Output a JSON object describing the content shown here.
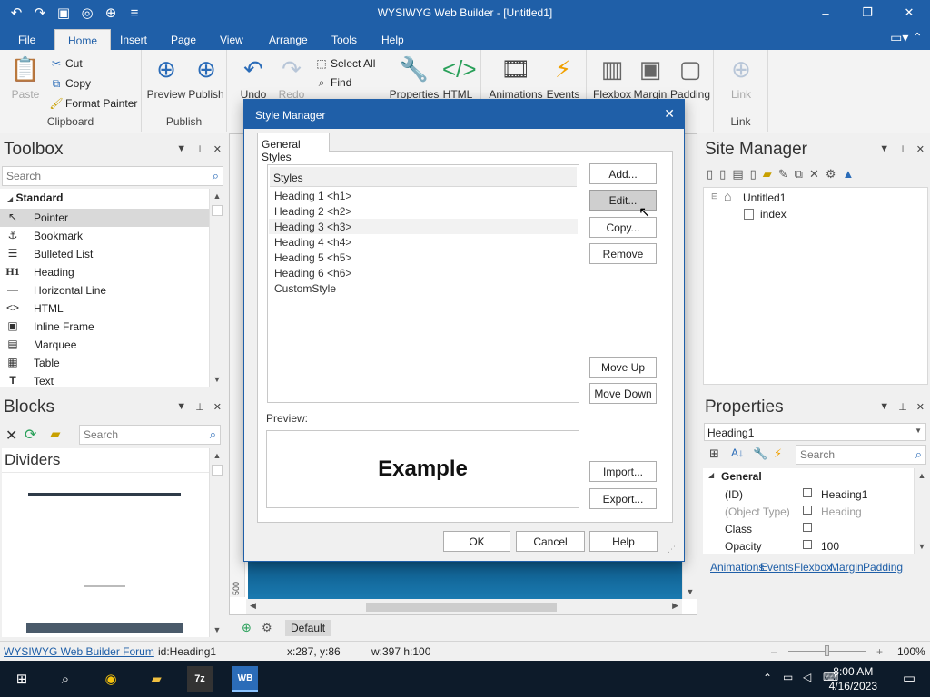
{
  "window": {
    "title": "WYSIWYG Web Builder - [Untitled1]",
    "minimize": "–",
    "restore": "❐",
    "close": "✕"
  },
  "ribbon_tabs": [
    {
      "label": "File",
      "active": false
    },
    {
      "label": "Home",
      "active": true
    },
    {
      "label": "Insert",
      "active": false
    },
    {
      "label": "Page",
      "active": false
    },
    {
      "label": "View",
      "active": false
    },
    {
      "label": "Arrange",
      "active": false
    },
    {
      "label": "Tools",
      "active": false
    },
    {
      "label": "Help",
      "active": false
    }
  ],
  "ribbon": {
    "clipboard": {
      "title": "Clipboard",
      "paste": "Paste",
      "cut": "Cut",
      "copy": "Copy",
      "format_painter": "Format Painter"
    },
    "publish": {
      "title": "Publish",
      "preview": "Preview",
      "publish": "Publish"
    },
    "edit": {
      "undo": "Undo",
      "redo": "Redo",
      "select_all": "Select All",
      "find": "Find"
    },
    "properties": {
      "properties": "Properties",
      "html": "HTML"
    },
    "animations": {
      "animations": "Animations",
      "events": "Events"
    },
    "layout": {
      "flexbox": "Flexbox",
      "margin": "Margin",
      "padding": "Padding"
    },
    "link": {
      "title": "Link",
      "link": "Link"
    }
  },
  "toolbox": {
    "title": "Toolbox",
    "search_placeholder": "Search",
    "category": "Standard",
    "items": [
      {
        "label": "Pointer",
        "icon": "↖"
      },
      {
        "label": "Bookmark",
        "icon": "⚓"
      },
      {
        "label": "Bulleted List",
        "icon": "☰"
      },
      {
        "label": "Heading",
        "icon": "H1"
      },
      {
        "label": "Horizontal Line",
        "icon": "—"
      },
      {
        "label": "HTML",
        "icon": "<>"
      },
      {
        "label": "Inline Frame",
        "icon": "▣"
      },
      {
        "label": "Marquee",
        "icon": "▤"
      },
      {
        "label": "Table",
        "icon": "▦"
      },
      {
        "label": "Text",
        "icon": "T"
      }
    ]
  },
  "blocks": {
    "title": "Blocks",
    "search_placeholder": "Search",
    "category": "Dividers"
  },
  "dialog": {
    "title": "Style Manager",
    "tab": "General Styles",
    "list_header": "Styles",
    "styles": [
      "Heading 1 <h1>",
      "Heading 2 <h2>",
      "Heading 3 <h3>",
      "Heading 4 <h4>",
      "Heading 5 <h5>",
      "Heading 6 <h6>",
      "CustomStyle"
    ],
    "buttons": {
      "add": "Add...",
      "edit": "Edit...",
      "copy": "Copy...",
      "remove": "Remove",
      "move_up": "Move Up",
      "move_down": "Move Down",
      "import": "Import...",
      "export": "Export...",
      "ok": "OK",
      "cancel": "Cancel",
      "help": "Help"
    },
    "preview_label": "Preview:",
    "preview_text": "Example"
  },
  "site_manager": {
    "title": "Site Manager",
    "root": "Untitled1",
    "page": "index"
  },
  "properties": {
    "title": "Properties",
    "selected": "Heading1",
    "search_placeholder": "Search",
    "section": "General",
    "rows": [
      {
        "key": "(ID)",
        "value": "Heading1",
        "dim": false
      },
      {
        "key": "(Object Type)",
        "value": "Heading",
        "dim": true
      },
      {
        "key": "Class",
        "value": "",
        "dim": false
      },
      {
        "key": "Opacity",
        "value": "100",
        "dim": false
      }
    ],
    "links": [
      "Animations",
      "Events",
      "Flexbox",
      "Margin",
      "Padding"
    ]
  },
  "canvas": {
    "default_label": "Default",
    "ruler_mark": "500"
  },
  "statusbar": {
    "forum": "WYSIWYG Web Builder Forum",
    "selection": "id:Heading1",
    "cursor": "x:287, y:86",
    "size": "w:397 h:100",
    "zoom": "100%"
  },
  "taskbar": {
    "time": "8:00 AM",
    "date": "4/16/2023"
  }
}
